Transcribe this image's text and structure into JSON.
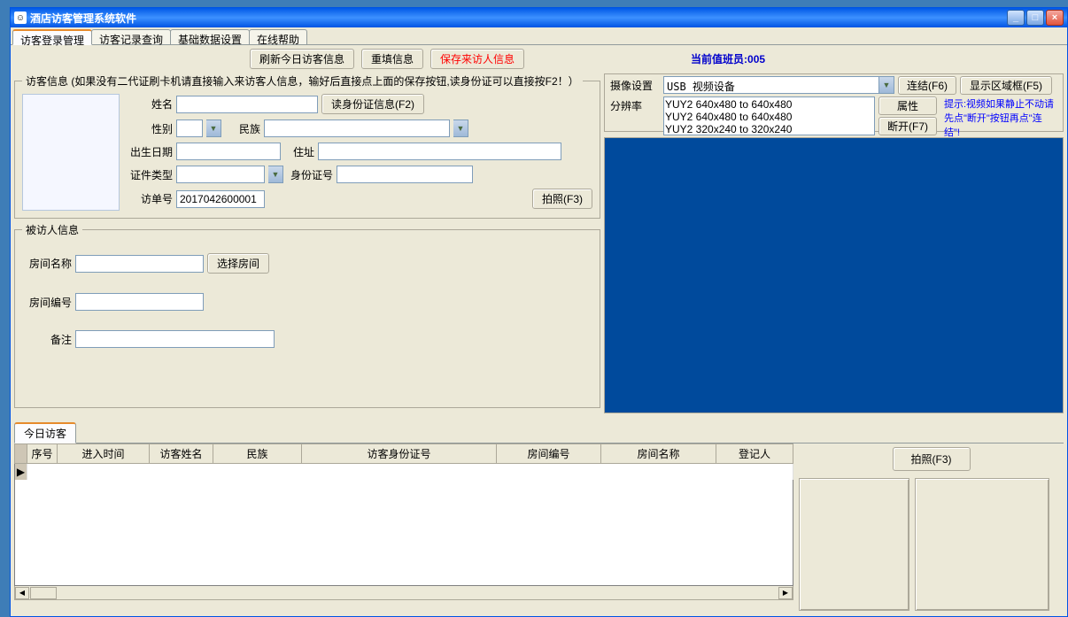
{
  "window": {
    "title": "酒店访客管理系统软件"
  },
  "tabs": [
    "访客登录管理",
    "访客记录查询",
    "基础数据设置",
    "在线帮助"
  ],
  "toolbar": {
    "refresh": "刷新今日访客信息",
    "refill": "重填信息",
    "save": "保存来访人信息"
  },
  "status": "当前值班员:005",
  "visitor_group": {
    "legend": "访客信息 (如果没有二代证刷卡机请直接输入来访客人信息，输好后直接点上面的保存按钮,读身份证可以直接按F2！）",
    "name_lbl": "姓名",
    "name_val": "",
    "read_id_btn": "读身份证信息(F2)",
    "gender_lbl": "性别",
    "gender_val": "",
    "ethnicity_lbl": "民族",
    "ethnicity_val": "",
    "birth_lbl": "出生日期",
    "birth_val": "",
    "addr_lbl": "住址",
    "addr_val": "",
    "id_type_lbl": "证件类型",
    "id_type_val": "",
    "id_no_lbl": "身份证号",
    "id_no_val": "",
    "visit_no_lbl": "访单号",
    "visit_no_val": "2017042600001",
    "photo_btn": "拍照(F3)"
  },
  "visited_group": {
    "legend": "被访人信息",
    "room_name_lbl": "房间名称",
    "room_name_val": "",
    "select_room_btn": "选择房间",
    "room_no_lbl": "房间编号",
    "room_no_val": "",
    "remark_lbl": "备注",
    "remark_val": ""
  },
  "camera": {
    "device_lbl": "摄像设置",
    "device_val": "USB 视频设备",
    "resolution_lbl": "分辨率",
    "res_options": [
      "YUY2 640x480 to 640x480",
      "YUY2 640x480 to 640x480",
      "YUY2 320x240 to 320x240"
    ],
    "connect_btn": "连结(F6)",
    "prop_btn": "属性",
    "disconnect_btn": "断开(F7)",
    "show_frame_btn": "显示区域框(F5)",
    "hint": "提示:视频如果静止不动请先点\"断开\"按钮再点\"连结\"!"
  },
  "bottom_tab": "今日访客",
  "grid": {
    "columns": [
      "序号",
      "进入时间",
      "访客姓名",
      "民族",
      "访客身份证号",
      "房间编号",
      "房间名称",
      "登记人"
    ]
  },
  "capture_btn": "拍照(F3)"
}
